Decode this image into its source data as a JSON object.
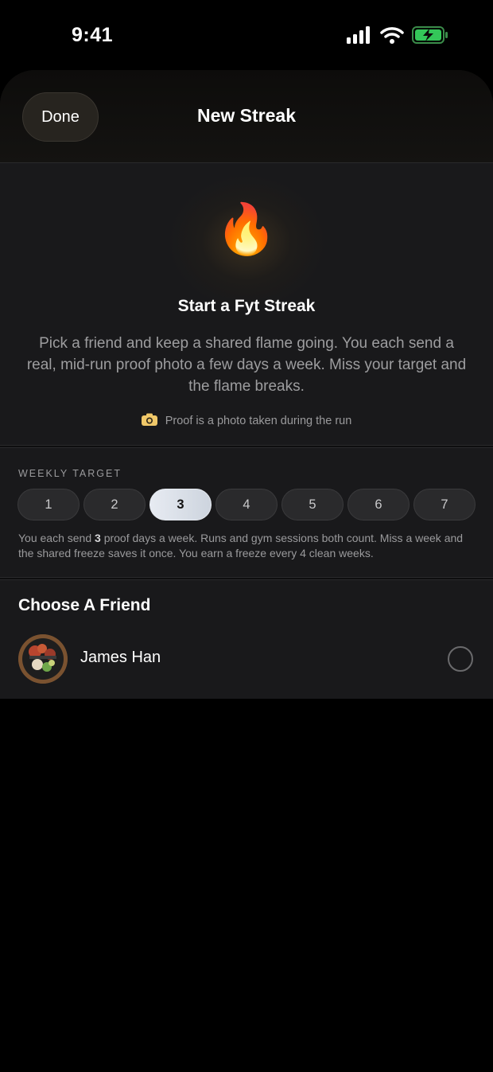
{
  "status_bar": {
    "time": "9:41",
    "icons": [
      "signal-icon",
      "wifi-icon",
      "battery-charging-icon"
    ]
  },
  "header": {
    "done_label": "Done",
    "title": "New Streak"
  },
  "hero": {
    "icon": "flame-emoji",
    "flame_glyph": "🔥",
    "title": "Start a Fyt Streak",
    "description": "Pick a friend and keep a shared flame going. You each send a real, mid-run proof photo a few days a week. Miss your target and the flame breaks.",
    "proof_icon": "camera-icon",
    "proof_note": "Proof is a photo taken during the run"
  },
  "weekly_target": {
    "label": "WEEKLY TARGET",
    "options": [
      "1",
      "2",
      "3",
      "4",
      "5",
      "6",
      "7"
    ],
    "selected": "3",
    "help_prefix": "You each send ",
    "help_value": "3",
    "help_suffix": " proof days a week. Runs and gym sessions both count. Miss a week and the shared freeze saves it once. You earn a freeze every 4 clean weeks."
  },
  "friends": {
    "heading": "Choose A Friend",
    "items": [
      {
        "name": "James Han",
        "selected": false
      }
    ]
  },
  "colors": {
    "background": "#000000",
    "card": "#19191b",
    "selected_pill": "#e7ebf2",
    "battery": "#34c759"
  }
}
